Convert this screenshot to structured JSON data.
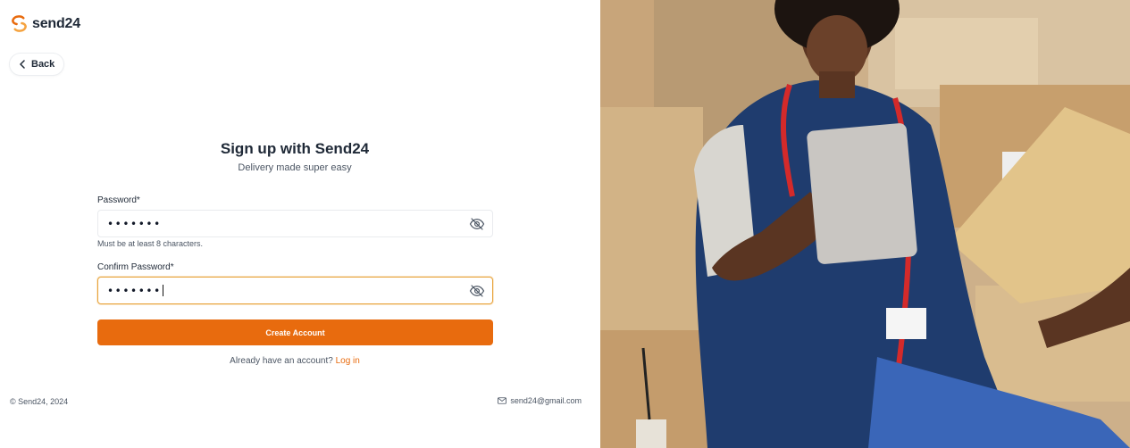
{
  "brand": {
    "name": "send24",
    "accent": "#e86b0e"
  },
  "nav": {
    "back_label": "Back"
  },
  "form": {
    "title": "Sign up with Send24",
    "subtitle": "Delivery made super easy",
    "password": {
      "label": "Password*",
      "value": "•••••••",
      "hint": "Must be at least 8 characters.",
      "toggle_icon": "eye-off-icon"
    },
    "confirm_password": {
      "label": "Confirm Password*",
      "value": "•••••••",
      "toggle_icon": "eye-off-icon"
    },
    "submit_label": "Create Account",
    "login_prompt": "Already have an account?",
    "login_link": "Log in"
  },
  "footer": {
    "copyright": "© Send24, 2024",
    "email": "send24@gmail.com",
    "email_icon": "mail-icon"
  },
  "hero": {
    "icon": "courier-with-tablet-photo"
  }
}
